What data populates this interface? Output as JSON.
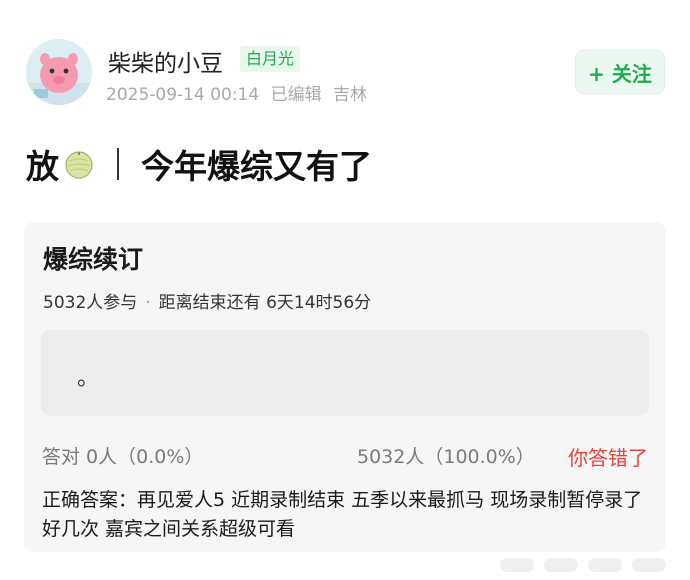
{
  "author": {
    "name": "柴柴的小豆",
    "badge": "白月光",
    "timestamp": "2025-09-14 00:14",
    "edited": "已编辑",
    "location": "吉林"
  },
  "follow_button": "+ 关注",
  "post": {
    "title_prefix": "放",
    "title_main": "今年爆综又有了"
  },
  "poll": {
    "title": "爆综续订",
    "participants": "5032人参与",
    "countdown": "距离结束还有 6天14时56分",
    "option_text": "。",
    "result_correct": "答对  0人（0.0%）",
    "result_total": "5032人（100.0%）",
    "result_status": "你答错了",
    "answer": "正确答案：再见爱人5 近期录制结束 五季以来最抓马 现场录制暂停录了好几次 嘉宾之间关系超级可看"
  },
  "colors": {
    "accent_green": "#1faa4f",
    "wrong_red": "#e0473c"
  }
}
